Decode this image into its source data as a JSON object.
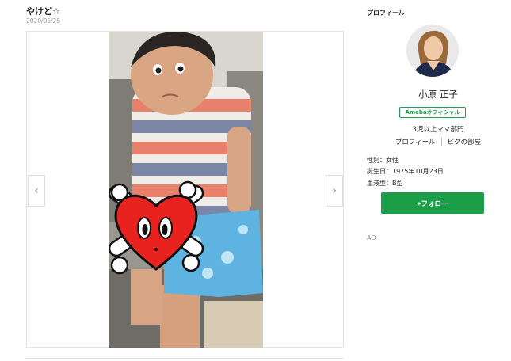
{
  "post": {
    "title": "やけど☆",
    "date": "2020/05/25"
  },
  "gallery": {
    "prev_icon": "chevron-left-icon",
    "next_icon": "chevron-right-icon",
    "prev_glyph": "‹",
    "next_glyph": "›"
  },
  "profile": {
    "heading": "プロフィール",
    "name": "小原 正子",
    "badge": "Amebaオフィシャル",
    "category": "3児以上ママ部門",
    "links": [
      "プロフィール",
      "ピグの部屋"
    ],
    "gender": "性別：女性",
    "birthday": "誕生日：1975年10月23日",
    "blood": "血液型：B型",
    "follow_label": "+フォロー"
  },
  "ad": {
    "label": "AD"
  },
  "colors": {
    "accent_green": "#1c9e48",
    "sticker_red": "#e8221f"
  }
}
